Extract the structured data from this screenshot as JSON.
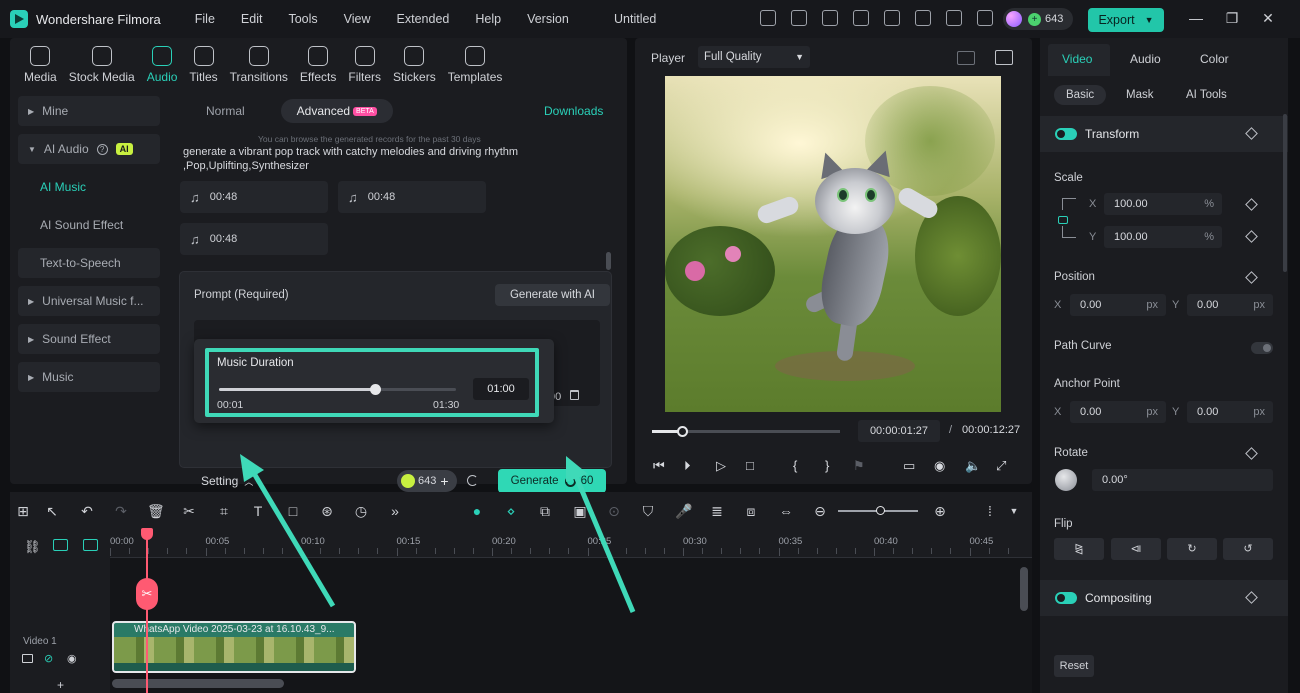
{
  "app": {
    "name": "Wondershare Filmora",
    "menu": [
      "File",
      "Edit",
      "Tools",
      "View",
      "Extended",
      "Help",
      "Version"
    ],
    "doc_title": "Untitled",
    "credits": "643",
    "export_label": "Export"
  },
  "toolbar_tabs": [
    {
      "label": "Media",
      "icon": "media-icon"
    },
    {
      "label": "Stock Media",
      "icon": "stock-media-icon"
    },
    {
      "label": "Audio",
      "icon": "audio-icon",
      "active": true
    },
    {
      "label": "Titles",
      "icon": "titles-icon"
    },
    {
      "label": "Transitions",
      "icon": "transitions-icon"
    },
    {
      "label": "Effects",
      "icon": "effects-icon"
    },
    {
      "label": "Filters",
      "icon": "filters-icon"
    },
    {
      "label": "Stickers",
      "icon": "stickers-icon"
    },
    {
      "label": "Templates",
      "icon": "templates-icon"
    }
  ],
  "sidebar": {
    "mine": "Mine",
    "ai_audio": "AI Audio",
    "ai_badge": "AI",
    "ai_music": "AI Music",
    "ai_sound_effect": "AI Sound Effect",
    "tts": "Text-to-Speech",
    "universal_music": "Universal Music f...",
    "sound_effect": "Sound Effect",
    "music": "Music"
  },
  "ai_music": {
    "tab_normal": "Normal",
    "tab_advanced": "Advanced",
    "beta": "BETA",
    "downloads": "Downloads",
    "hint": "You can browse the generated records for the past 30 days",
    "generated_prompt": "generate a vibrant pop track with catchy melodies and driving rhythm ,Pop,Uplifting,Synthesizer",
    "tracks": [
      "00:48",
      "00:48",
      "00:48"
    ],
    "prompt_label": "Prompt (Required)",
    "generate_with_ai": "Generate with AI",
    "partial_time": "00",
    "setting_label": "Setting",
    "credit_count": "643",
    "generate_label": "Generate",
    "generate_cost": "60",
    "duration": {
      "title": "Music Duration",
      "value": "01:00",
      "min": "00:01",
      "max": "01:30",
      "progress": 0.66
    }
  },
  "player": {
    "label": "Player",
    "quality": "Full Quality",
    "current_time": "00:00:01:27",
    "separator": "/",
    "total_time": "00:00:12:27",
    "progress": 0.16
  },
  "properties": {
    "tabs": [
      "Video",
      "Audio",
      "Color"
    ],
    "sub_tabs": [
      "Basic",
      "Mask",
      "AI Tools"
    ],
    "transform": "Transform",
    "scale": "Scale",
    "scale_x": "100.00",
    "scale_y": "100.00",
    "percent": "%",
    "position": "Position",
    "pos_x": "0.00",
    "pos_y": "0.00",
    "px": "px",
    "path_curve": "Path Curve",
    "anchor_point": "Anchor Point",
    "anchor_x": "0.00",
    "anchor_y": "0.00",
    "rotate": "Rotate",
    "rotate_value": "0.00°",
    "flip": "Flip",
    "compositing": "Compositing",
    "reset": "Reset",
    "x": "X",
    "y": "Y"
  },
  "timeline": {
    "ticks": [
      "00:00",
      "00:05",
      "00:10",
      "00:15",
      "00:20",
      "00:25",
      "00:30",
      "00:35",
      "00:40",
      "00:45"
    ],
    "track_label": "Video 1",
    "clip_title": "WhatsApp Video 2025-03-23 at 16.10.43_9..."
  },
  "colors": {
    "accent": "#2ad0b8",
    "highlight": "#3fd9b8",
    "playhead": "#ff5a72"
  }
}
